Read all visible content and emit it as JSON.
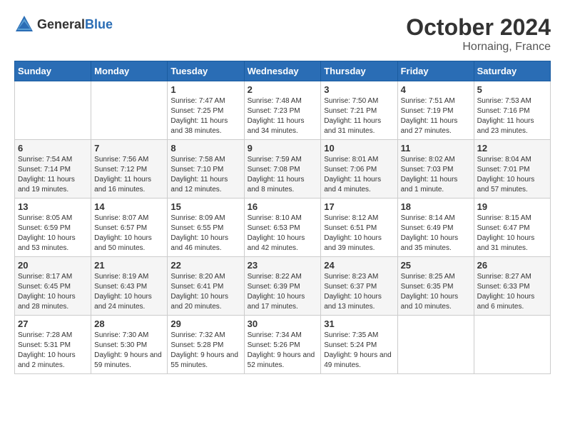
{
  "header": {
    "logo_general": "General",
    "logo_blue": "Blue",
    "month": "October 2024",
    "location": "Hornaing, France"
  },
  "weekdays": [
    "Sunday",
    "Monday",
    "Tuesday",
    "Wednesday",
    "Thursday",
    "Friday",
    "Saturday"
  ],
  "weeks": [
    [
      {
        "day": "",
        "info": ""
      },
      {
        "day": "",
        "info": ""
      },
      {
        "day": "1",
        "info": "Sunrise: 7:47 AM\nSunset: 7:25 PM\nDaylight: 11 hours and 38 minutes."
      },
      {
        "day": "2",
        "info": "Sunrise: 7:48 AM\nSunset: 7:23 PM\nDaylight: 11 hours and 34 minutes."
      },
      {
        "day": "3",
        "info": "Sunrise: 7:50 AM\nSunset: 7:21 PM\nDaylight: 11 hours and 31 minutes."
      },
      {
        "day": "4",
        "info": "Sunrise: 7:51 AM\nSunset: 7:19 PM\nDaylight: 11 hours and 27 minutes."
      },
      {
        "day": "5",
        "info": "Sunrise: 7:53 AM\nSunset: 7:16 PM\nDaylight: 11 hours and 23 minutes."
      }
    ],
    [
      {
        "day": "6",
        "info": "Sunrise: 7:54 AM\nSunset: 7:14 PM\nDaylight: 11 hours and 19 minutes."
      },
      {
        "day": "7",
        "info": "Sunrise: 7:56 AM\nSunset: 7:12 PM\nDaylight: 11 hours and 16 minutes."
      },
      {
        "day": "8",
        "info": "Sunrise: 7:58 AM\nSunset: 7:10 PM\nDaylight: 11 hours and 12 minutes."
      },
      {
        "day": "9",
        "info": "Sunrise: 7:59 AM\nSunset: 7:08 PM\nDaylight: 11 hours and 8 minutes."
      },
      {
        "day": "10",
        "info": "Sunrise: 8:01 AM\nSunset: 7:06 PM\nDaylight: 11 hours and 4 minutes."
      },
      {
        "day": "11",
        "info": "Sunrise: 8:02 AM\nSunset: 7:03 PM\nDaylight: 11 hours and 1 minute."
      },
      {
        "day": "12",
        "info": "Sunrise: 8:04 AM\nSunset: 7:01 PM\nDaylight: 10 hours and 57 minutes."
      }
    ],
    [
      {
        "day": "13",
        "info": "Sunrise: 8:05 AM\nSunset: 6:59 PM\nDaylight: 10 hours and 53 minutes."
      },
      {
        "day": "14",
        "info": "Sunrise: 8:07 AM\nSunset: 6:57 PM\nDaylight: 10 hours and 50 minutes."
      },
      {
        "day": "15",
        "info": "Sunrise: 8:09 AM\nSunset: 6:55 PM\nDaylight: 10 hours and 46 minutes."
      },
      {
        "day": "16",
        "info": "Sunrise: 8:10 AM\nSunset: 6:53 PM\nDaylight: 10 hours and 42 minutes."
      },
      {
        "day": "17",
        "info": "Sunrise: 8:12 AM\nSunset: 6:51 PM\nDaylight: 10 hours and 39 minutes."
      },
      {
        "day": "18",
        "info": "Sunrise: 8:14 AM\nSunset: 6:49 PM\nDaylight: 10 hours and 35 minutes."
      },
      {
        "day": "19",
        "info": "Sunrise: 8:15 AM\nSunset: 6:47 PM\nDaylight: 10 hours and 31 minutes."
      }
    ],
    [
      {
        "day": "20",
        "info": "Sunrise: 8:17 AM\nSunset: 6:45 PM\nDaylight: 10 hours and 28 minutes."
      },
      {
        "day": "21",
        "info": "Sunrise: 8:19 AM\nSunset: 6:43 PM\nDaylight: 10 hours and 24 minutes."
      },
      {
        "day": "22",
        "info": "Sunrise: 8:20 AM\nSunset: 6:41 PM\nDaylight: 10 hours and 20 minutes."
      },
      {
        "day": "23",
        "info": "Sunrise: 8:22 AM\nSunset: 6:39 PM\nDaylight: 10 hours and 17 minutes."
      },
      {
        "day": "24",
        "info": "Sunrise: 8:23 AM\nSunset: 6:37 PM\nDaylight: 10 hours and 13 minutes."
      },
      {
        "day": "25",
        "info": "Sunrise: 8:25 AM\nSunset: 6:35 PM\nDaylight: 10 hours and 10 minutes."
      },
      {
        "day": "26",
        "info": "Sunrise: 8:27 AM\nSunset: 6:33 PM\nDaylight: 10 hours and 6 minutes."
      }
    ],
    [
      {
        "day": "27",
        "info": "Sunrise: 7:28 AM\nSunset: 5:31 PM\nDaylight: 10 hours and 2 minutes."
      },
      {
        "day": "28",
        "info": "Sunrise: 7:30 AM\nSunset: 5:30 PM\nDaylight: 9 hours and 59 minutes."
      },
      {
        "day": "29",
        "info": "Sunrise: 7:32 AM\nSunset: 5:28 PM\nDaylight: 9 hours and 55 minutes."
      },
      {
        "day": "30",
        "info": "Sunrise: 7:34 AM\nSunset: 5:26 PM\nDaylight: 9 hours and 52 minutes."
      },
      {
        "day": "31",
        "info": "Sunrise: 7:35 AM\nSunset: 5:24 PM\nDaylight: 9 hours and 49 minutes."
      },
      {
        "day": "",
        "info": ""
      },
      {
        "day": "",
        "info": ""
      }
    ]
  ]
}
